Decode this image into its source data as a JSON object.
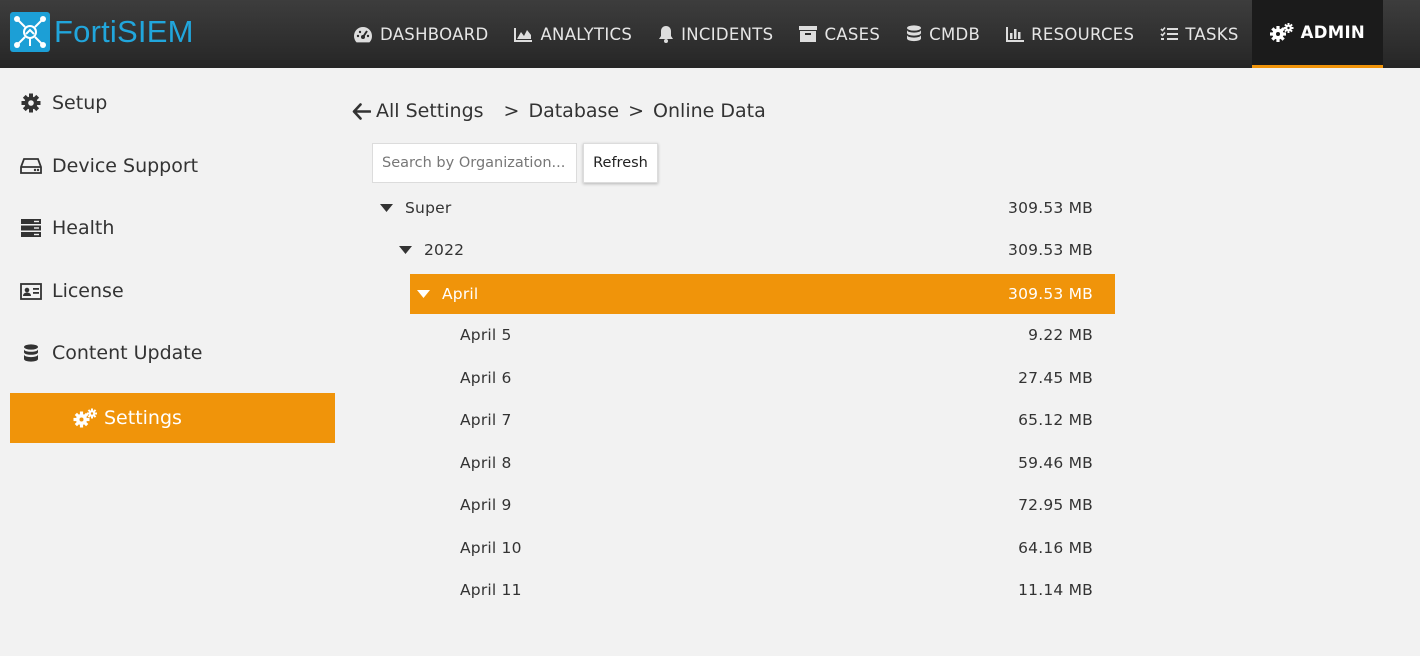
{
  "app": {
    "brand": "FortiSIEM",
    "accent": "#f0940a",
    "brand_color": "#21a6dc"
  },
  "nav": {
    "items": [
      {
        "label": "DASHBOARD",
        "icon": "dashboard-icon"
      },
      {
        "label": "ANALYTICS",
        "icon": "area-chart-icon"
      },
      {
        "label": "INCIDENTS",
        "icon": "bell-icon"
      },
      {
        "label": "CASES",
        "icon": "archive-icon"
      },
      {
        "label": "CMDB",
        "icon": "database-icon"
      },
      {
        "label": "RESOURCES",
        "icon": "bar-chart-icon"
      },
      {
        "label": "TASKS",
        "icon": "tasks-icon"
      },
      {
        "label": "ADMIN",
        "icon": "cogs-icon",
        "active": true
      }
    ]
  },
  "sidebar": {
    "items": [
      {
        "label": "Setup",
        "icon": "gear-icon"
      },
      {
        "label": "Device Support",
        "icon": "hdd-icon"
      },
      {
        "label": "Health",
        "icon": "server-icon"
      },
      {
        "label": "License",
        "icon": "id-card-icon"
      },
      {
        "label": "Content Update",
        "icon": "database-icon"
      },
      {
        "label": "Settings",
        "icon": "cogs-icon",
        "active": true
      }
    ]
  },
  "breadcrumb": {
    "back_label": "All Settings",
    "path1": "Database",
    "path2": "Online Data",
    "separator": ">"
  },
  "search": {
    "placeholder": "Search by Organization...",
    "value": ""
  },
  "refresh_label": "Refresh",
  "tree": [
    {
      "label": "Super",
      "size": "309.53 MB",
      "level": 0,
      "expanded": true
    },
    {
      "label": "2022",
      "size": "309.53 MB",
      "level": 1,
      "expanded": true
    },
    {
      "label": "April",
      "size": "309.53 MB",
      "level": 2,
      "expanded": true,
      "selected": true
    },
    {
      "label": "April 5",
      "size": "9.22 MB",
      "level": 3
    },
    {
      "label": "April 6",
      "size": "27.45 MB",
      "level": 3
    },
    {
      "label": "April 7",
      "size": "65.12 MB",
      "level": 3
    },
    {
      "label": "April 8",
      "size": "59.46 MB",
      "level": 3
    },
    {
      "label": "April 9",
      "size": "72.95 MB",
      "level": 3
    },
    {
      "label": "April 10",
      "size": "64.16 MB",
      "level": 3
    },
    {
      "label": "April 11",
      "size": "11.14 MB",
      "level": 3
    }
  ]
}
